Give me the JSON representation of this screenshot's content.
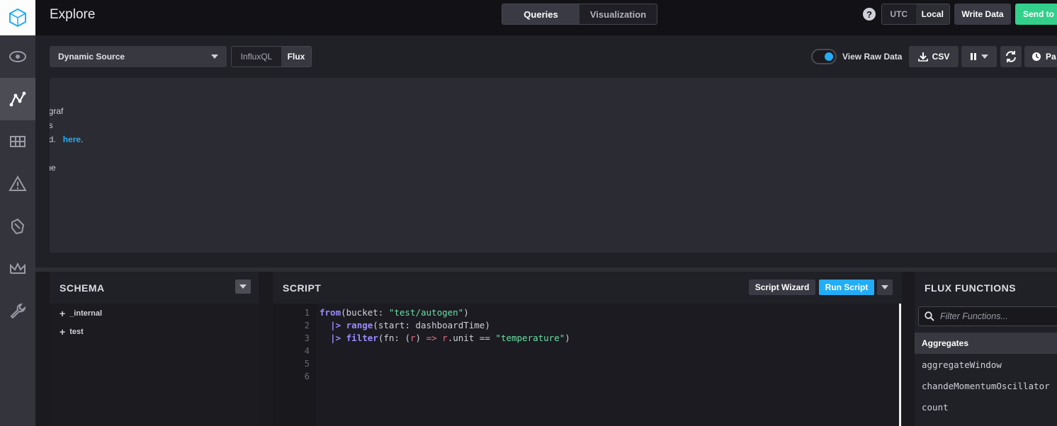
{
  "header": {
    "title": "Explore",
    "modes": [
      "Queries",
      "Visualization"
    ],
    "active_mode": "Queries",
    "help": "?",
    "timezones": [
      "UTC",
      "Local"
    ],
    "active_timezone": "Local",
    "write_data": "Write Data",
    "send_to": "Send to"
  },
  "toolbar": {
    "source": "Dynamic Source",
    "languages": [
      "InfluxQL",
      "Flux"
    ],
    "active_language": "Flux",
    "raw_data_label": "View Raw Data",
    "csv_label": "CSV",
    "past_label": "Pa"
  },
  "viz_message": {
    "line1": "ograf",
    "line2": "as",
    "line3_prefix": "ed.",
    "line3_link": "here",
    "line3_suffix": ".",
    "line4": "e",
    "line5": "the"
  },
  "schema": {
    "title": "SCHEMA",
    "items": [
      "_internal",
      "test"
    ]
  },
  "script": {
    "title": "SCRIPT",
    "wizard": "Script Wizard",
    "run": "Run Script",
    "line_numbers": [
      "1",
      "2",
      "3",
      "4",
      "5",
      "6"
    ],
    "code": {
      "l1_kw": "from",
      "l1_a": "(bucket: ",
      "l1_str": "\"test/autogen\"",
      "l1_b": ")",
      "l2_pipe": "|>",
      "l2_kw": "range",
      "l2_rest": "(start: dashboardTime)",
      "l3_pipe": "|>",
      "l3_kw": "filter",
      "l3_a": "(fn: (",
      "l3_param": "r",
      "l3_b": ") ",
      "l3_arrow": "=>",
      "l3_c": " ",
      "l3_param2": "r",
      "l3_d": ".unit == ",
      "l3_str": "\"temperature\"",
      "l3_e": ")"
    }
  },
  "functions": {
    "title": "FLUX FUNCTIONS",
    "filter_placeholder": "Filter Functions...",
    "category": "Aggregates",
    "items": [
      "aggregateWindow",
      "chandeMomentumOscillator",
      "count"
    ]
  },
  "colors": {
    "accent_blue": "#22adf6",
    "send_green": "#32d08b",
    "keyword": "#9b8cff",
    "string": "#6bdfa4"
  }
}
